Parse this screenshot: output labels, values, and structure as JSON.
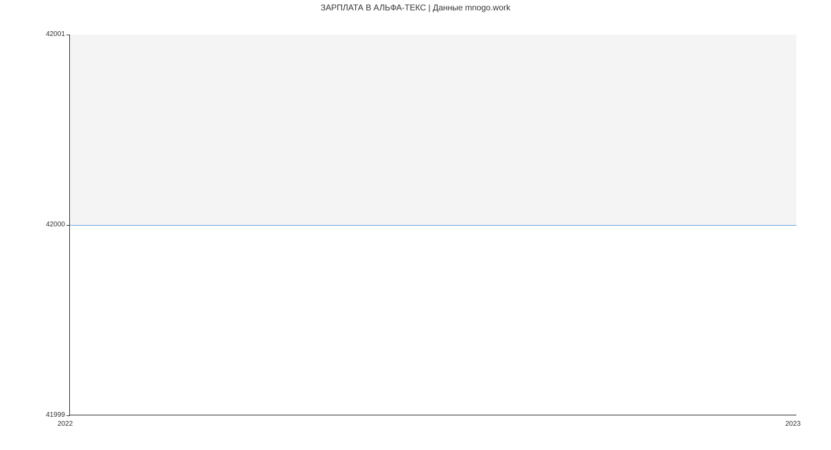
{
  "title": "ЗАРПЛАТА В  АЛЬФА-ТЕКС | Данные mnogo.work",
  "y_ticks": {
    "top": "42001",
    "mid": "42000",
    "bot": "41999"
  },
  "x_ticks": {
    "left": "2022",
    "right": "2023"
  },
  "chart_data": {
    "type": "line",
    "title": "ЗАРПЛАТА В  АЛЬФА-ТЕКС | Данные mnogo.work",
    "xlabel": "",
    "ylabel": "",
    "x": [
      "2022",
      "2023"
    ],
    "values": [
      42000,
      42000
    ],
    "ylim": [
      41999,
      42001
    ],
    "series_color": "#6fa8dc",
    "fill_above_midline": "#f4f4f4"
  }
}
